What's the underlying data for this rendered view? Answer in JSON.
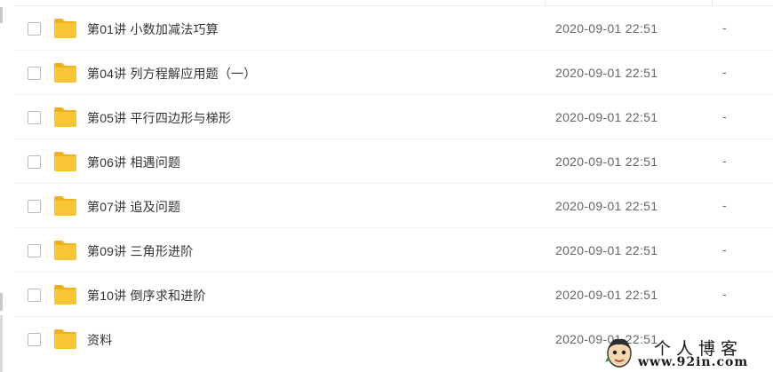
{
  "files": [
    {
      "name": "第01讲 小数加减法巧算",
      "modified": "2020-09-01 22:51",
      "size": "-",
      "icon": "folder-icon",
      "checked": false
    },
    {
      "name": "第04讲 列方程解应用题（一）",
      "modified": "2020-09-01 22:51",
      "size": "-",
      "icon": "folder-icon",
      "checked": false
    },
    {
      "name": "第05讲 平行四边形与梯形",
      "modified": "2020-09-01 22:51",
      "size": "-",
      "icon": "folder-icon",
      "checked": false
    },
    {
      "name": "第06讲 相遇问题",
      "modified": "2020-09-01 22:51",
      "size": "-",
      "icon": "folder-icon",
      "checked": false
    },
    {
      "name": "第07讲 追及问题",
      "modified": "2020-09-01 22:51",
      "size": "-",
      "icon": "folder-icon",
      "checked": false
    },
    {
      "name": "第09讲 三角形进阶",
      "modified": "2020-09-01 22:51",
      "size": "-",
      "icon": "folder-icon",
      "checked": false
    },
    {
      "name": "第10讲 倒序求和进阶",
      "modified": "2020-09-01 22:51",
      "size": "-",
      "icon": "folder-icon",
      "checked": false
    },
    {
      "name": "资料",
      "modified": "2020-09-01 22:51",
      "size": "",
      "icon": "folder-icon",
      "checked": false
    }
  ],
  "watermark": {
    "title": "个人博客",
    "url": "www.92in.com"
  },
  "colors": {
    "folder": "#f8c635",
    "folder_tab": "#efb21e",
    "text": "#333333",
    "muted": "#666666",
    "divider": "#f1f1f1"
  }
}
